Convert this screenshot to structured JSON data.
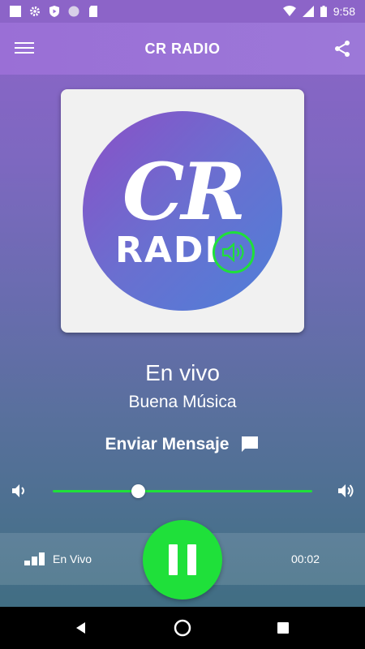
{
  "status_bar": {
    "time": "9:58",
    "icons": [
      "square-icon",
      "gear-icon",
      "shield-play-icon",
      "circle-icon",
      "sd-card-icon",
      "wifi-icon",
      "signal-icon",
      "battery-icon"
    ]
  },
  "app_bar": {
    "title": "CR RADIO",
    "menu_icon": "hamburger-menu-icon",
    "share_icon": "share-icon"
  },
  "artwork": {
    "logo_text_top": "CR",
    "logo_text_bottom": "RADI",
    "speaker_icon": "speaker-icon"
  },
  "now_playing": {
    "title": "En vivo",
    "subtitle": "Buena Música"
  },
  "message": {
    "label": "Enviar Mensaje",
    "icon": "chat-bubble-icon"
  },
  "volume": {
    "level_percent": 33,
    "accent_color": "#1fe03a"
  },
  "player": {
    "live_label": "En Vivo",
    "elapsed": "00:02",
    "state_icon": "pause-icon",
    "accent_color": "#1fe03a"
  },
  "nav_bar": {
    "buttons": [
      "back-icon",
      "home-icon",
      "recent-apps-icon"
    ]
  }
}
